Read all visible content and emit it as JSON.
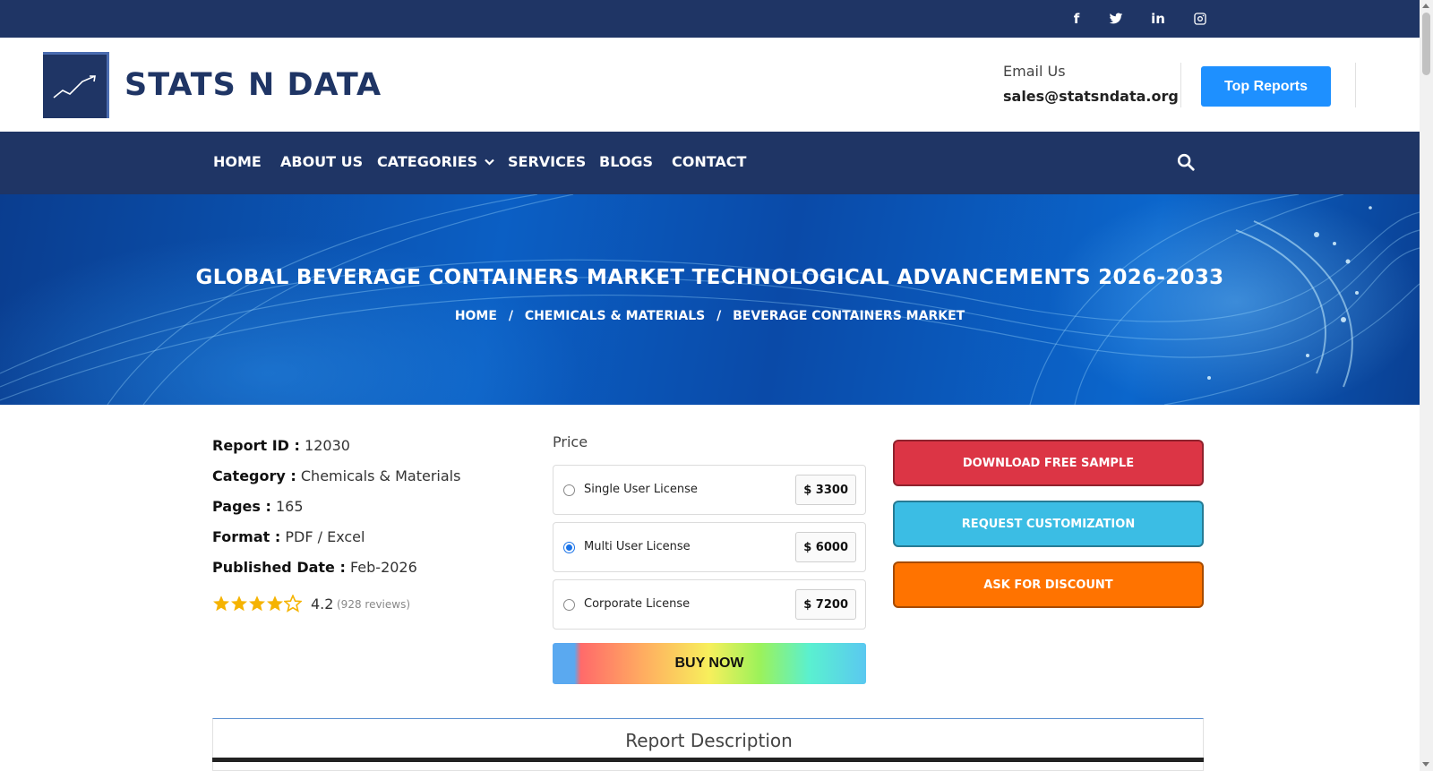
{
  "social": {
    "facebook": "f",
    "twitter": "twitter-icon",
    "linkedin": "in",
    "instagram": "instagram-icon"
  },
  "header": {
    "brand": "STATS N DATA",
    "email_label": "Email Us",
    "email_value": "sales@statsndata.org",
    "top_reports": "Top Reports"
  },
  "nav": {
    "items": [
      "HOME",
      "ABOUT US",
      "CATEGORIES",
      "SERVICES",
      "BLOGS",
      "CONTACT"
    ],
    "categories_chevron": "⌄"
  },
  "hero": {
    "title": "GLOBAL BEVERAGE CONTAINERS MARKET TECHNOLOGICAL ADVANCEMENTS 2026-2033",
    "breadcrumb": [
      "HOME",
      "CHEMICALS & MATERIALS",
      "BEVERAGE CONTAINERS MARKET"
    ],
    "separator": "/"
  },
  "details": {
    "report_id_label": "Report ID :",
    "report_id": "12030",
    "category_label": "Category :",
    "category": "Chemicals & Materials",
    "pages_label": "Pages :",
    "pages": "165",
    "format_label": "Format :",
    "format": "PDF / Excel",
    "published_label": "Published Date :",
    "published": "Feb-2026",
    "rating": "4.2",
    "rating_value": 4.2,
    "rating_max": 5,
    "reviews": "(928 reviews)"
  },
  "pricing": {
    "label": "Price",
    "licenses": [
      {
        "name": "Single User License",
        "price": "$ 3300",
        "selected": false
      },
      {
        "name": "Multi User License",
        "price": "$ 6000",
        "selected": true
      },
      {
        "name": "Corporate License",
        "price": "$ 7200",
        "selected": false
      }
    ],
    "buy_now": "BUY NOW"
  },
  "actions": {
    "download_sample": "DOWNLOAD FREE SAMPLE",
    "request_customization": "REQUEST CUSTOMIZATION",
    "ask_discount": "ASK FOR DISCOUNT"
  },
  "colors": {
    "navy": "#1f3565",
    "top_reports_blue": "#1e90ff",
    "download_red": "#dc3545",
    "customization_cyan": "#3bbde4",
    "discount_orange": "#ff7300"
  },
  "description": {
    "title": "Report Description"
  }
}
